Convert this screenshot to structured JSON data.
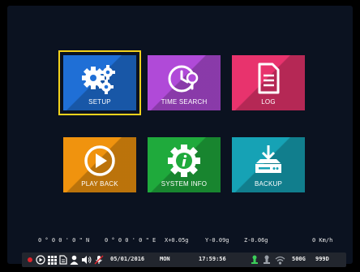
{
  "menu": {
    "tiles": [
      {
        "label": "SETUP",
        "color": "#1f6fd6",
        "icon": "gears-icon",
        "selected": true
      },
      {
        "label": "TIME SEARCH",
        "color": "#b04ad8",
        "icon": "clock-search-icon",
        "selected": false
      },
      {
        "label": "LOG",
        "color": "#e8336d",
        "icon": "document-icon",
        "selected": false
      },
      {
        "label": "PLAY BACK",
        "color": "#f0930e",
        "icon": "play-icon",
        "selected": false
      },
      {
        "label": "SYSTEM INFO",
        "color": "#1faa3c",
        "icon": "gear-info-icon",
        "selected": false
      },
      {
        "label": "BACKUP",
        "color": "#16a2b5",
        "icon": "backup-drive-icon",
        "selected": false
      }
    ],
    "selection_color": "#f2d21c"
  },
  "sensors": {
    "latitude": "0 ° 0 0 ' 0 \" N",
    "longitude": "0 ° 0 0 ' 0 \" E",
    "accel_x": "X+0.05g",
    "accel_y": "Y-0.09g",
    "accel_z": "Z-0.06g",
    "speed": "0 Km/h"
  },
  "status": {
    "date": "05/01/2016",
    "weekday": "MON",
    "time": "17:59:56",
    "storage": "500G",
    "days": "999D",
    "icons": [
      "record-dot-icon",
      "play-circle-icon",
      "grid-icon",
      "file-icon",
      "person-icon",
      "speaker-icon",
      "mic-off-icon",
      "gps-icon",
      "battery-icon",
      "wifi-icon"
    ]
  }
}
